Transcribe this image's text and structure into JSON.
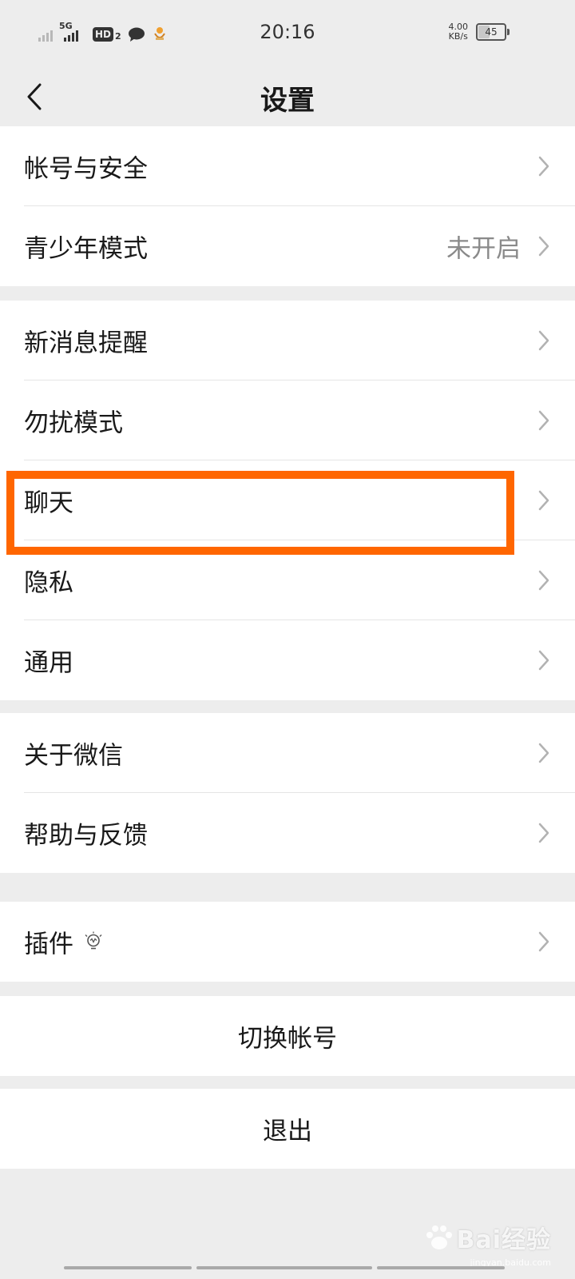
{
  "status_bar": {
    "network": "5G",
    "hd": "HD",
    "hd_sub": "2",
    "time": "20:16",
    "speed_value": "4.00",
    "speed_unit": "KB/s",
    "battery": "45",
    "icons": [
      "signal-icon",
      "5g-signal-icon",
      "hd-icon",
      "chat-bubble-icon",
      "weather-icon",
      "battery-icon"
    ]
  },
  "nav": {
    "title": "设置"
  },
  "groups": [
    {
      "items": [
        {
          "label": "帐号与安全",
          "value": ""
        },
        {
          "label": "青少年模式",
          "value": "未开启"
        }
      ]
    },
    {
      "items": [
        {
          "label": "新消息提醒",
          "value": ""
        },
        {
          "label": "勿扰模式",
          "value": ""
        },
        {
          "label": "聊天",
          "value": ""
        },
        {
          "label": "隐私",
          "value": ""
        },
        {
          "label": "通用",
          "value": ""
        }
      ]
    },
    {
      "items": [
        {
          "label": "关于微信",
          "value": ""
        },
        {
          "label": "帮助与反馈",
          "value": ""
        }
      ]
    },
    {
      "items": [
        {
          "label": "插件",
          "value": ""
        }
      ]
    }
  ],
  "actions": {
    "switch_account": "切换帐号",
    "logout": "退出"
  },
  "watermark": {
    "text": "Bai经验",
    "sub": "jingyan.baidu.com"
  },
  "colors": {
    "background": "#ededed",
    "highlight": "#ff6600",
    "text": "#191919",
    "muted": "#8a8a8a"
  }
}
